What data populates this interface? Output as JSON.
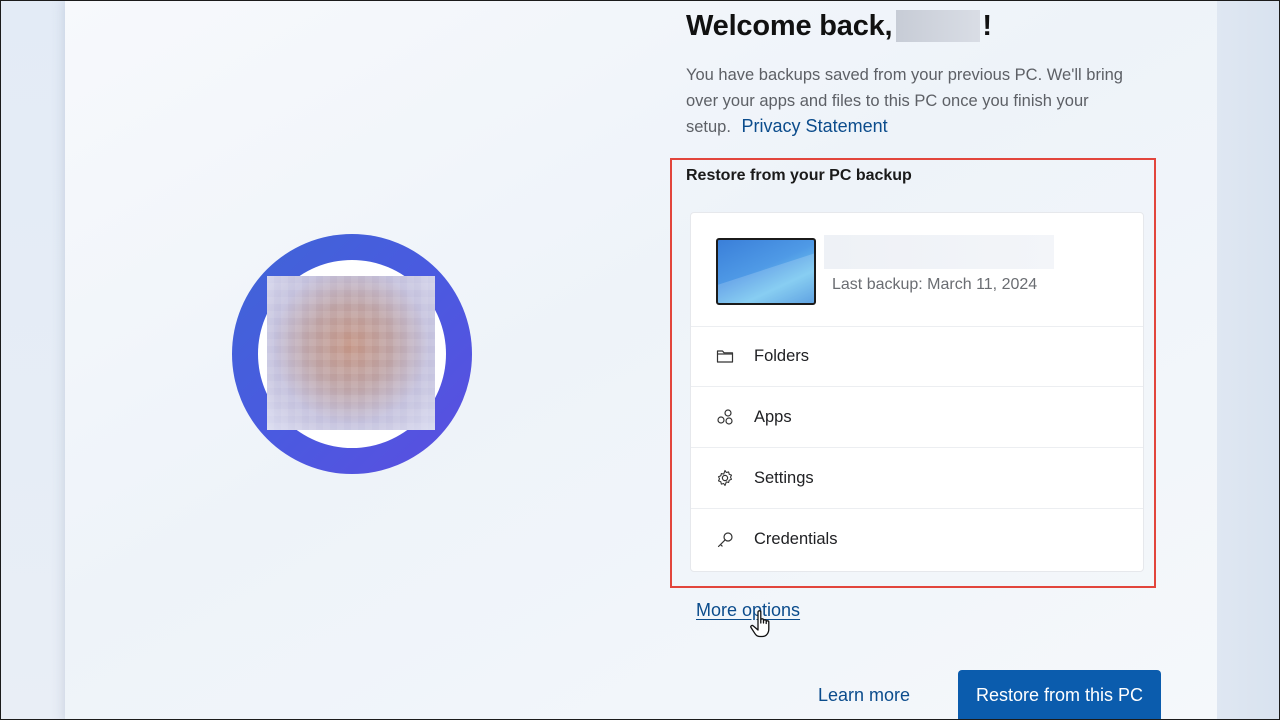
{
  "header": {
    "title_prefix": "Welcome back,",
    "title_suffix": "!",
    "description": "You have backups saved from your previous PC. We'll bring over your apps and files to this PC once you finish your setup.",
    "privacy_link": "Privacy Statement"
  },
  "restore_section": {
    "title": "Restore from your PC backup",
    "device": {
      "last_backup": "Last backup: March 11, 2024"
    },
    "items": [
      {
        "label": "Folders",
        "icon": "folder-icon"
      },
      {
        "label": "Apps",
        "icon": "apps-icon"
      },
      {
        "label": "Settings",
        "icon": "gear-icon"
      },
      {
        "label": "Credentials",
        "icon": "key-icon"
      }
    ]
  },
  "footer": {
    "more_options": "More options",
    "learn_more": "Learn more",
    "restore_button": "Restore from this PC"
  },
  "colors": {
    "accent": "#0b5cad",
    "link": "#0b4c8c",
    "highlight": "#e2453c",
    "avatar_ring": "#4a5ae0"
  }
}
